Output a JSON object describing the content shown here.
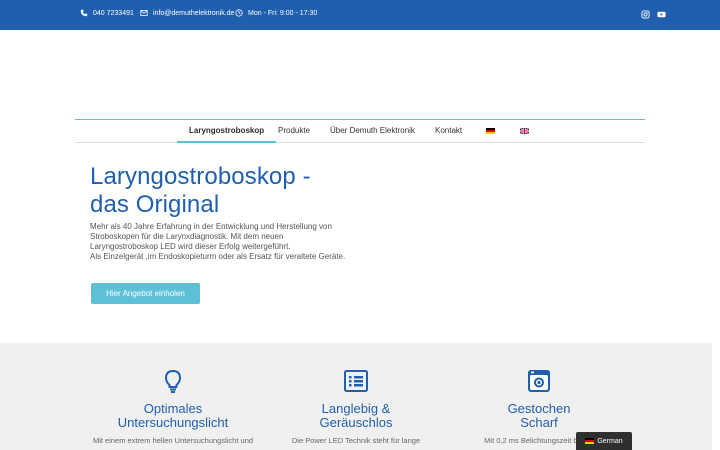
{
  "topbar": {
    "phone": "040 7233491",
    "email": "info@demuthelektronik.de",
    "hours": "Mon - Fri: 9:00 - 17:30"
  },
  "nav": {
    "items": [
      {
        "label": "Laryngostroboskop"
      },
      {
        "label": "Produkte"
      },
      {
        "label": "Über Demuth Elektronik"
      },
      {
        "label": "Kontakt"
      }
    ]
  },
  "hero": {
    "title_line1": "Laryngostroboskop -",
    "title_line2": "das Original",
    "text_line1": "Mehr als 40 Jahre Erfahrung in der Entwicklung und Herstellung von",
    "text_line2": "Stroboskopen für die Larynxdiagnostik. Mit dem neuen",
    "text_line3": "Laryngostroboskop LED wird dieser Erfolg weitergeführt.",
    "text_line4": "Als Einzelgerät ,im Endoskopieturm oder als Ersatz für veraltete Geräte.",
    "cta_label": "Hier Angebot einholen"
  },
  "features": [
    {
      "title_line1": "Optimales",
      "title_line2": "Untersuchungslicht",
      "text": "Mit einem extrem hellen Untersuchungslicht und"
    },
    {
      "title_line1": "Langlebig &",
      "title_line2": "Geräuschlos",
      "text": "Die Power LED Technik steht für lange"
    },
    {
      "title_line1": "Gestochen",
      "title_line2": "Scharf",
      "text": "Mit 0,2 ms Belichtungszeit bei 10"
    }
  ],
  "language": {
    "label": "German"
  },
  "colors": {
    "primary": "#1f5fae",
    "accent": "#5ec0d6",
    "feature_bg": "#f0f0f0"
  }
}
